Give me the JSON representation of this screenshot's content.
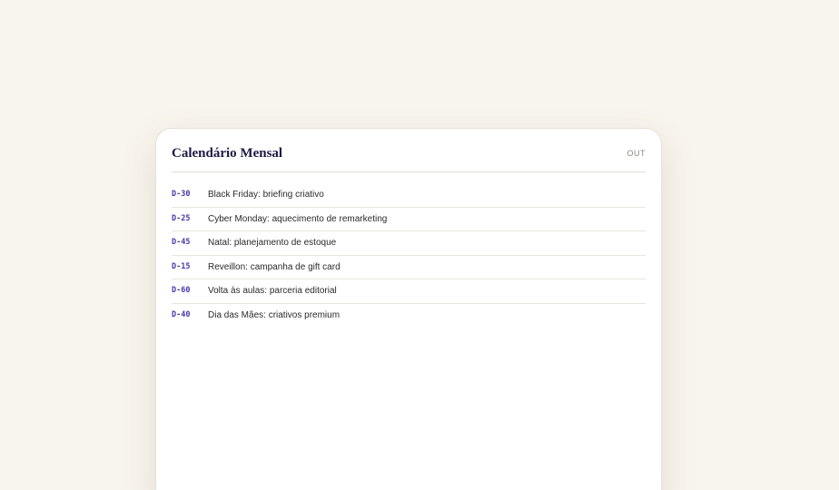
{
  "calendar": {
    "title": "Calendário Mensal",
    "month": "OUT",
    "events": [
      {
        "code": "D-30",
        "text": "Black Friday: briefing criativo"
      },
      {
        "code": "D-25",
        "text": "Cyber Monday: aquecimento de remarketing"
      },
      {
        "code": "D-45",
        "text": "Natal: planejamento de estoque"
      },
      {
        "code": "D-15",
        "text": "Reveillon: campanha de gift card"
      },
      {
        "code": "D-60",
        "text": "Volta às aulas: parceria editorial"
      },
      {
        "code": "D-40",
        "text": "Dia das Mães: criativos premium"
      }
    ]
  },
  "colors": {
    "background": "#f8f5ee",
    "card": "#ffffff",
    "title": "#1d1a44",
    "code_accent": "#4b37a6"
  }
}
